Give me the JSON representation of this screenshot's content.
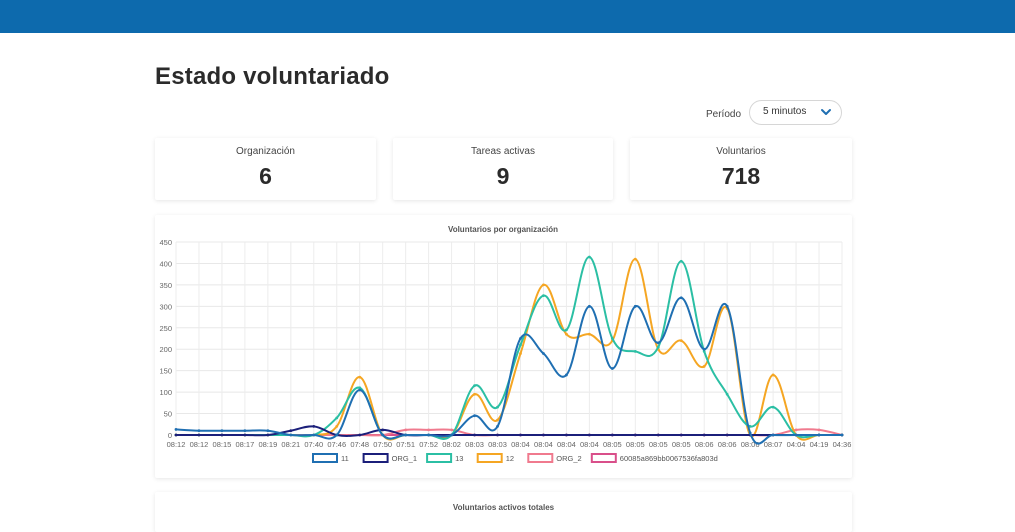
{
  "header": {
    "color": "#0d6aad"
  },
  "page": {
    "title": "Estado voluntariado"
  },
  "period": {
    "label": "Período",
    "value": "5 minutos",
    "icon": "chevron-down-icon"
  },
  "stats": [
    {
      "label": "Organización",
      "value": "6"
    },
    {
      "label": "Tareas activas",
      "value": "9"
    },
    {
      "label": "Voluntarios",
      "value": "718"
    }
  ],
  "chart2": {
    "title": "Voluntarios activos totales"
  },
  "chart_data": {
    "type": "line",
    "title": "Voluntarios por organización",
    "xlabel": "",
    "ylabel": "",
    "ylim": [
      0,
      450
    ],
    "yticks": [
      0,
      50,
      100,
      150,
      200,
      250,
      300,
      350,
      400,
      450
    ],
    "grid": true,
    "legend": "bottom",
    "categories": [
      "08:12",
      "08:12",
      "08:15",
      "08:17",
      "08:19",
      "08:21",
      "07:40",
      "07:46",
      "07:48",
      "07:50",
      "07:51",
      "07:52",
      "08:02",
      "08:03",
      "08:03",
      "08:04",
      "08:04",
      "08:04",
      "08:04",
      "08:05",
      "08:05",
      "08:05",
      "08:05",
      "08:06",
      "08:06",
      "08:06",
      "08:07",
      "04:04",
      "04:19",
      "04:36"
    ],
    "series": [
      {
        "name": "11",
        "color": "#1f6fb2",
        "values": [
          13,
          10,
          10,
          10,
          10,
          0,
          0,
          0,
          105,
          0,
          0,
          0,
          0,
          45,
          20,
          225,
          190,
          140,
          300,
          155,
          300,
          215,
          320,
          200,
          300,
          5,
          0,
          0,
          0,
          0
        ]
      },
      {
        "name": "ORG_1",
        "color": "#1b1f7a",
        "values": [
          0,
          0,
          0,
          0,
          0,
          10,
          20,
          0,
          0,
          12,
          0,
          0,
          0,
          0,
          0,
          0,
          0,
          0,
          0,
          0,
          0,
          0,
          0,
          0,
          0,
          0,
          0,
          0,
          0,
          0
        ]
      },
      {
        "name": "13",
        "color": "#2bbfa4",
        "values": [
          0,
          0,
          0,
          0,
          0,
          0,
          0,
          40,
          110,
          0,
          0,
          0,
          0,
          115,
          65,
          210,
          325,
          245,
          415,
          225,
          195,
          205,
          405,
          195,
          95,
          20,
          65,
          0,
          0,
          0
        ]
      },
      {
        "name": "12",
        "color": "#f5a623",
        "values": [
          0,
          0,
          0,
          0,
          0,
          0,
          0,
          20,
          135,
          0,
          0,
          0,
          0,
          95,
          35,
          190,
          350,
          235,
          235,
          220,
          410,
          200,
          220,
          160,
          295,
          0,
          140,
          0,
          0,
          0
        ]
      },
      {
        "name": "ORG_2",
        "color": "#f07a8e",
        "values": [
          0,
          0,
          0,
          0,
          0,
          0,
          0,
          0,
          0,
          0,
          12,
          12,
          12,
          0,
          0,
          0,
          0,
          0,
          0,
          0,
          0,
          0,
          0,
          0,
          0,
          0,
          0,
          12,
          12,
          0
        ]
      },
      {
        "name": "60085a869bb0067536fa803d",
        "color": "#d94f8a",
        "values": [
          0,
          0,
          0,
          0,
          0,
          0,
          0,
          0,
          0,
          0,
          0,
          0,
          0,
          0,
          0,
          0,
          0,
          0,
          0,
          0,
          0,
          0,
          0,
          0,
          0,
          0,
          0,
          0,
          0,
          0
        ]
      }
    ]
  }
}
